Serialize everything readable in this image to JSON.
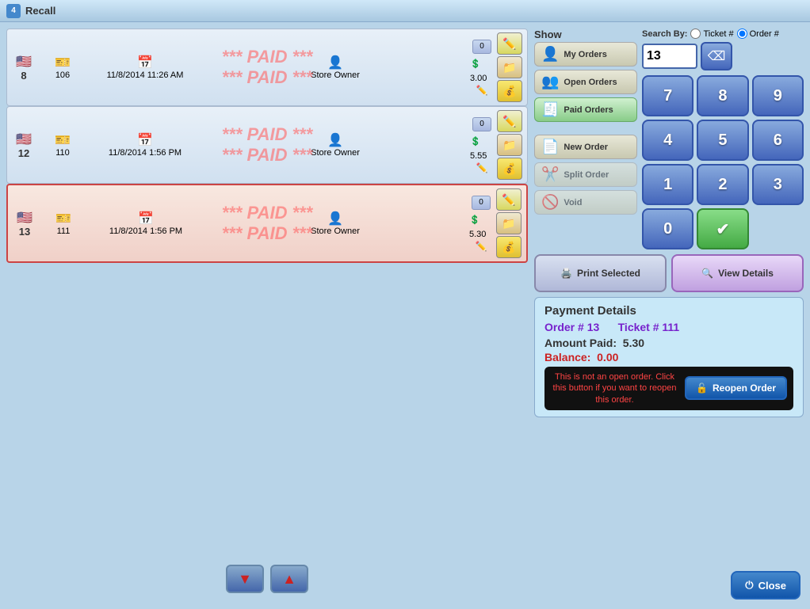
{
  "titlebar": {
    "icon": "4",
    "title": "Recall"
  },
  "orders": [
    {
      "id": 1,
      "num": "8",
      "ticket": "106",
      "date": "11/8/2014 11:26 AM",
      "owner": "Store Owner",
      "status": "0",
      "amount": "3.00",
      "paid": true,
      "paid_text": "*** PAID ***",
      "selected": false
    },
    {
      "id": 2,
      "num": "12",
      "ticket": "110",
      "date": "11/8/2014 1:56 PM",
      "owner": "Store Owner",
      "status": "0",
      "amount": "5.55",
      "paid": true,
      "paid_text": "*** PAID ***",
      "selected": false
    },
    {
      "id": 3,
      "num": "13",
      "ticket": "111",
      "date": "11/8/2014 1:56 PM",
      "owner": "Store Owner",
      "status": "0",
      "amount": "5.30",
      "paid": true,
      "paid_text": "*** PAID ***",
      "selected": true
    }
  ],
  "show": {
    "label": "Show",
    "my_orders": "My Orders",
    "open_orders": "Open Orders",
    "paid_orders": "Paid Orders",
    "new_order": "New Order",
    "split_order": "Split Order",
    "void": "Void"
  },
  "search": {
    "label": "Search By:",
    "ticket_label": "Ticket #",
    "order_label": "Order #",
    "value": "13"
  },
  "numpad": {
    "keys": [
      "7",
      "8",
      "9",
      "4",
      "5",
      "6",
      "1",
      "2",
      "3",
      "0"
    ]
  },
  "actions": {
    "print_selected": "Print Selected",
    "view_details": "View Details"
  },
  "payment": {
    "title": "Payment Details",
    "order_label": "Order #",
    "order_num": "13",
    "ticket_label": "Ticket #",
    "ticket_num": "111",
    "amount_label": "Amount Paid:",
    "amount_value": "5.30",
    "balance_label": "Balance:",
    "balance_value": "0.00",
    "reopen_warning": "This is not an open order. Click this button if you want to reopen this order.",
    "reopen_btn": "Reopen Order"
  },
  "nav": {
    "down_label": "↓",
    "up_label": "↑"
  },
  "close_label": "Close"
}
